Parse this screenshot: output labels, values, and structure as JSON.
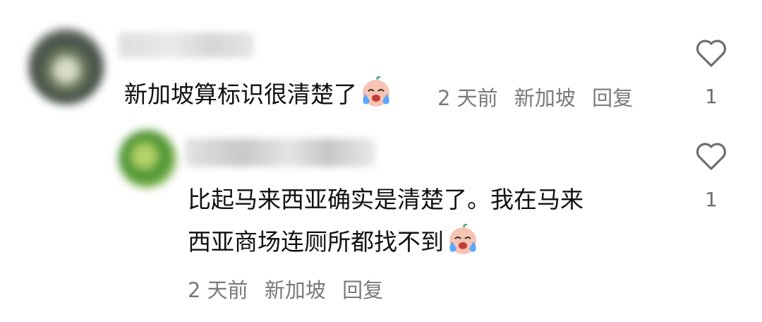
{
  "comments": [
    {
      "text": "新加坡算标识很清楚了",
      "emoji": "crying-face-emoji",
      "time": "2 天前",
      "location": "新加坡",
      "reply_label": "回复",
      "likes": "1"
    },
    {
      "line1": "比起马来西亚确实是清楚了。我在马来",
      "line2": "西亚商场连厕所都找不到",
      "emoji": "crying-face-emoji",
      "time": "2 天前",
      "location": "新加坡",
      "reply_label": "回复",
      "likes": "1"
    }
  ],
  "icons": {
    "like": "heart-outline-icon"
  },
  "colors": {
    "text": "#111111",
    "meta": "#7a7a7a",
    "heart": "#6e6e6e"
  }
}
